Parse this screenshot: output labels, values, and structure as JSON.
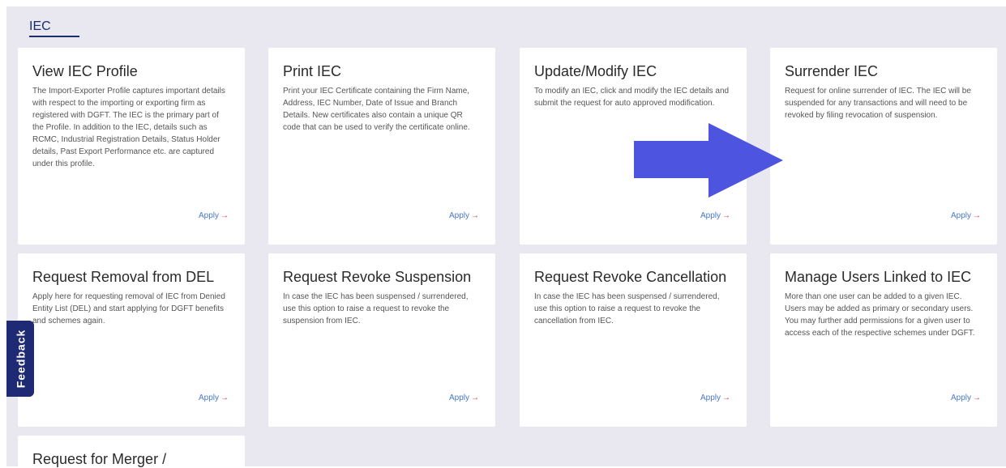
{
  "section": {
    "title": "IEC"
  },
  "colors": {
    "panel_bg": "#e9e8f1",
    "heading": "#1a2e6c",
    "link": "#4a78c8",
    "arrow_accent": "#d9363e",
    "overlay_arrow": "#4d55e0",
    "feedback_bg": "#1e2a74"
  },
  "feedback": {
    "label": "Feedback"
  },
  "apply_arrow_glyph": "→",
  "cards": [
    {
      "title": "View IEC Profile",
      "desc": "The Import-Exporter Profile captures important details with respect to the importing or exporting firm as registered with DGFT. The IEC is the primary part of the Profile. In addition to the IEC, details such as RCMC, Industrial Registration Details, Status Holder details, Past Export Performance etc. are captured under this profile.",
      "apply": "Apply"
    },
    {
      "title": "Print IEC",
      "desc": "Print your IEC Certificate containing the Firm Name, Address, IEC Number, Date of Issue and Branch Details. New certificates also contain a unique QR code that can be used to verify the certificate online.",
      "apply": "Apply"
    },
    {
      "title": "Update/Modify IEC",
      "desc": "To modify an IEC, click and modify the IEC details and submit the request for auto approved modification.",
      "apply": "Apply"
    },
    {
      "title": "Surrender IEC",
      "desc": "Request for online surrender of IEC. The IEC will be suspended for any transactions and will need to be revoked by filing revocation of suspension.",
      "apply": "Apply"
    },
    {
      "title": "Request Removal from DEL",
      "desc": "Apply here for requesting removal of IEC from Denied Entity List (DEL) and start applying for DGFT benefits and schemes again.",
      "apply": "Apply"
    },
    {
      "title": "Request Revoke Suspension",
      "desc": "In case the IEC has been suspensed / surrendered, use this option to raise a request to revoke the suspension from IEC.",
      "apply": "Apply"
    },
    {
      "title": "Request Revoke Cancellation",
      "desc": "In case the IEC has been suspensed / surrendered, use this option to raise a request to revoke the cancellation from IEC.",
      "apply": "Apply"
    },
    {
      "title": "Manage Users Linked to IEC",
      "desc": "More than one user can be added to a given IEC. Users may be added as primary or secondary users. You may further add permissions for a given user to access each of the respective schemes under DGFT.",
      "apply": "Apply"
    },
    {
      "title": "Request for Merger /",
      "desc": "",
      "apply": ""
    }
  ]
}
